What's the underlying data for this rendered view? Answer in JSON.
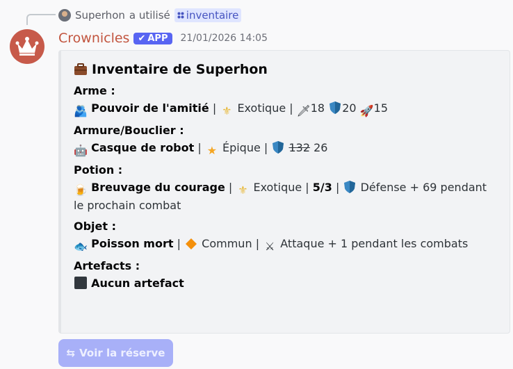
{
  "reply": {
    "user": "Superhon",
    "action": "a utilisé",
    "command": "inventaire"
  },
  "message": {
    "username": "Crownicles",
    "app_badge": "APP",
    "timestamp": "21/01/2026 14:05"
  },
  "embed": {
    "title": "Inventaire de Superhon",
    "fields": [
      {
        "name": "Arme :",
        "item": "Pouvoir de l'amitié",
        "rarity": "Exotique",
        "stats": [
          "18",
          "20",
          "15"
        ]
      },
      {
        "name": "Armure/Bouclier :",
        "item": "Casque de robot",
        "rarity": "Épique",
        "old_value": "132",
        "new_value": "26"
      },
      {
        "name": "Potion :",
        "item": "Breuvage du courage",
        "rarity": "Exotique",
        "count": "5/3",
        "effect": "Défense + 69 pendant le prochain combat"
      },
      {
        "name": "Objet :",
        "item": "Poisson mort",
        "rarity": "Commun",
        "effect": "Attaque + 1 pendant les combats"
      },
      {
        "name": "Artefacts :",
        "item": "Aucun artefact"
      }
    ]
  },
  "button": {
    "label": "Voir la réserve"
  },
  "colors": {
    "accent": "#5865f2",
    "username": "#c2553f",
    "button_disabled": "#a8b0f8"
  },
  "icons": [
    "briefcase-icon",
    "people-hugging-icon",
    "exotic-trident-icon",
    "dagger-icon",
    "shield-icon",
    "rocket-icon",
    "robot-icon",
    "star-icon",
    "beer-mug-icon",
    "blue-fish-icon",
    "orange-diamond-icon",
    "crossed-swords-icon",
    "black-square-icon",
    "crown-icon"
  ]
}
